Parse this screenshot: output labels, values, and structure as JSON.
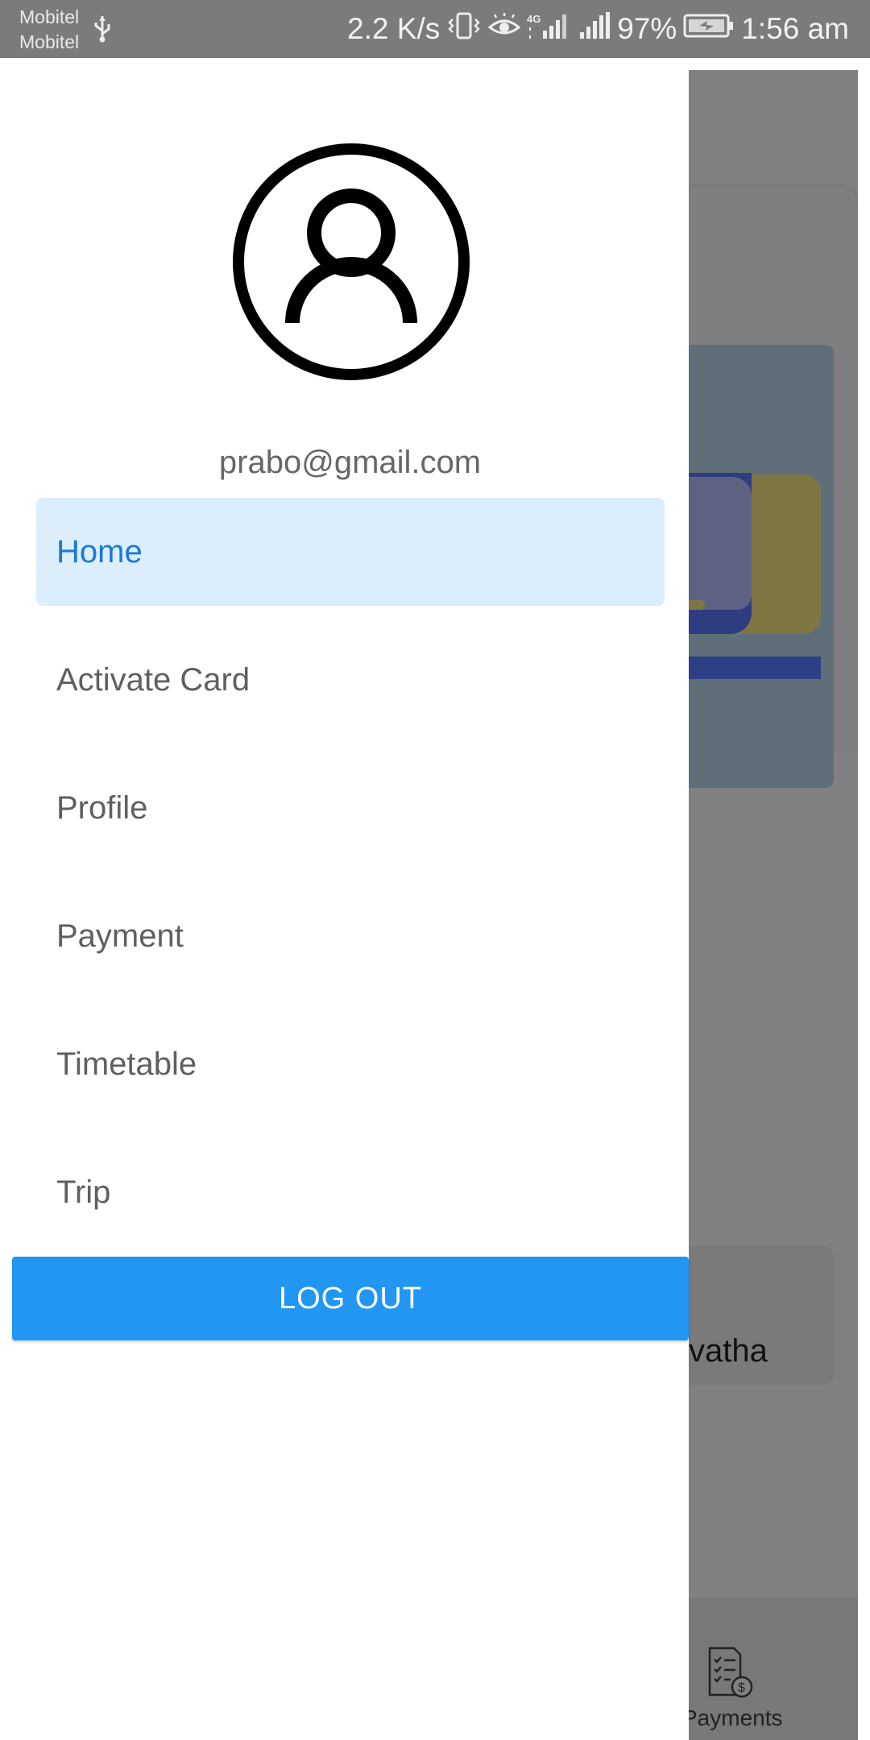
{
  "status_bar": {
    "carrier_1": "Mobitel",
    "carrier_2": "Mobitel",
    "net_speed": "2.2 K/s",
    "battery": "97%",
    "time": "1:56 am",
    "icons": [
      "usb-icon",
      "vibrate-icon",
      "eye-icon",
      "signal-4g-icon",
      "signal-icon",
      "battery-charging-icon"
    ]
  },
  "drawer": {
    "avatar_icon": "account-circle-icon",
    "email": "prabo@gmail.com",
    "menu": [
      {
        "label": "Home",
        "active": true
      },
      {
        "label": "Activate Card",
        "active": false
      },
      {
        "label": "Profile",
        "active": false
      },
      {
        "label": "Payment",
        "active": false
      },
      {
        "label": "Timetable",
        "active": false
      },
      {
        "label": "Trip",
        "active": false
      }
    ],
    "logout_label": "LOG OUT"
  },
  "background": {
    "name_fragment": "vatha",
    "nav_label_fragment": "Payments",
    "nav_icon": "invoice-dollar-icon"
  },
  "colors": {
    "accent": "#2196f3",
    "active_item_bg": "#dcedfc",
    "active_item_text": "#1a79d6",
    "status_bar": "#7b7b7b",
    "scrim": "#808080"
  }
}
